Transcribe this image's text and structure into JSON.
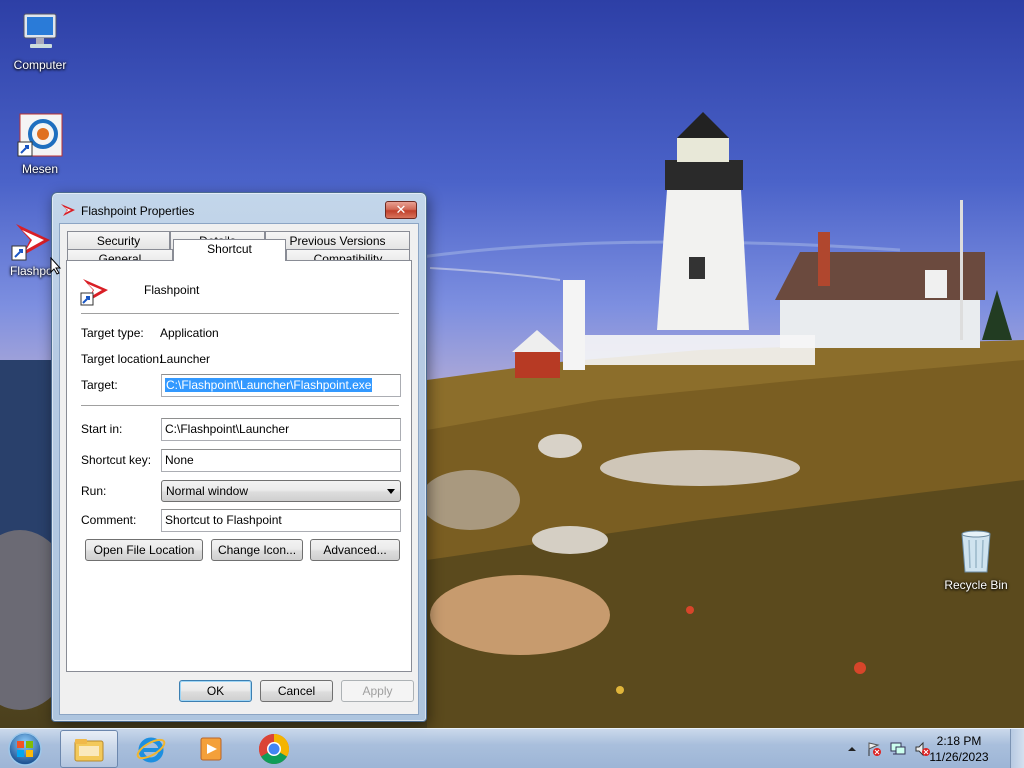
{
  "desktop": {
    "icons": [
      {
        "label": "Computer"
      },
      {
        "label": "Mesen"
      },
      {
        "label": "Flashpo"
      },
      {
        "label": "Recycle Bin"
      }
    ]
  },
  "dialog": {
    "title": "Flashpoint Properties",
    "close_glyph": "✕",
    "tabs_row1": [
      "Security",
      "Details",
      "Previous Versions"
    ],
    "tabs_row2": [
      "General",
      "Shortcut",
      "Compatibility"
    ],
    "active_tab": "Shortcut",
    "app_name": "Flashpoint",
    "target_type_label": "Target type:",
    "target_type_value": "Application",
    "target_location_label": "Target location:",
    "target_location_value": "Launcher",
    "target_label": "Target:",
    "target_value": "C:\\Flashpoint\\Launcher\\Flashpoint.exe",
    "start_in_label": "Start in:",
    "start_in_value": "C:\\Flashpoint\\Launcher",
    "shortcut_key_label": "Shortcut key:",
    "shortcut_key_value": "None",
    "run_label": "Run:",
    "run_value": "Normal window",
    "comment_label": "Comment:",
    "comment_value": "Shortcut to Flashpoint",
    "buttons": {
      "open_file_location": "Open File Location",
      "change_icon": "Change Icon...",
      "advanced": "Advanced...",
      "ok": "OK",
      "cancel": "Cancel",
      "apply": "Apply"
    }
  },
  "taskbar": {
    "pinned": [
      "explorer-icon",
      "internet-explorer-icon",
      "media-player-icon",
      "chrome-icon"
    ],
    "time": "2:18 PM",
    "date": "11/26/2023"
  },
  "colors": {
    "selection": "#3399ff",
    "taskbar": "#a9bfdc",
    "dialog_frame": "#b6cbe3"
  }
}
